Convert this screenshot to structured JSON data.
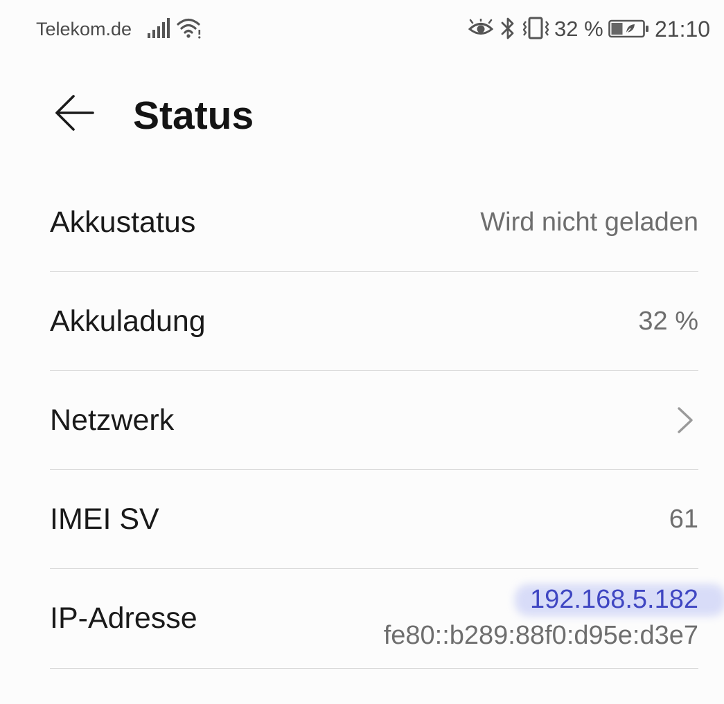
{
  "statusbar": {
    "carrier": "Telekom.de",
    "battery_percent": "32 %",
    "time": "21:10",
    "icons": [
      "signal-icon",
      "wifi-icon",
      "eye-icon",
      "bluetooth-icon",
      "vibrate-icon",
      "battery-icon"
    ]
  },
  "header": {
    "title": "Status",
    "back_icon": "arrow-left-icon"
  },
  "rows": [
    {
      "label": "Akkustatus",
      "value": "Wird nicht geladen"
    },
    {
      "label": "Akkuladung",
      "value": "32 %"
    },
    {
      "label": "Netzwerk",
      "value": "",
      "icon": "chevron-right-icon"
    },
    {
      "label": "IMEI SV",
      "value": "61"
    },
    {
      "label": "IP-Adresse",
      "ipv4": "192.168.5.182",
      "ipv6": "fe80::b289:88f0:d95e:d3e7"
    }
  ],
  "colors": {
    "background": "#fcfcfc",
    "highlight": "#3f46c2",
    "secondary_text": "#6e6e6e",
    "divider": "#d6d6d6"
  }
}
